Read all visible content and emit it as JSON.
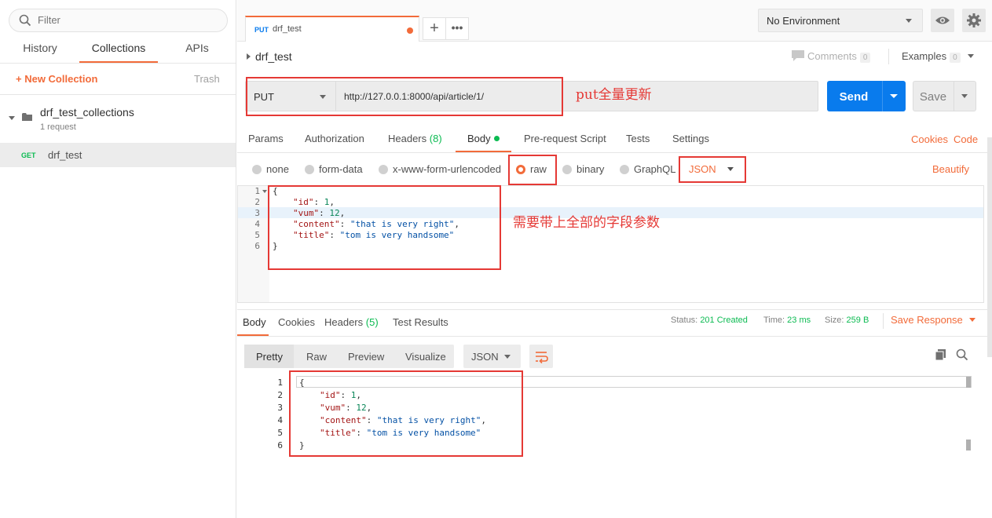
{
  "sidebar": {
    "filter_placeholder": "Filter",
    "tabs": [
      "History",
      "Collections",
      "APIs"
    ],
    "new_collection": "+ New Collection",
    "trash": "Trash",
    "collection": {
      "name": "drf_test_collections",
      "count": "1 request"
    },
    "request": {
      "method": "GET",
      "name": "drf_test"
    }
  },
  "topbar": {
    "tab": {
      "method": "PUT",
      "name": "drf_test"
    },
    "add_tab": "+",
    "more_tabs": "•••",
    "environment": "No Environment",
    "icons": [
      "eye-icon",
      "gear-icon"
    ]
  },
  "request": {
    "title": "drf_test",
    "comments_label": "Comments",
    "comments_count": "0",
    "examples_label": "Examples",
    "examples_count": "0",
    "method": "PUT",
    "url": "http://127.0.0.1:8000/api/article/1/",
    "send_label": "Send",
    "save_label": "Save",
    "tabs": {
      "params": "Params",
      "authorization": "Authorization",
      "headers": "Headers",
      "headers_count": "(8)",
      "body": "Body",
      "prerequest": "Pre-request Script",
      "tests": "Tests",
      "settings": "Settings"
    },
    "cookies_link": "Cookies",
    "code_link": "Code",
    "body_modes": [
      "none",
      "form-data",
      "x-www-form-urlencoded",
      "raw",
      "binary",
      "GraphQL"
    ],
    "selected_mode": "raw",
    "language": "JSON",
    "beautify": "Beautify",
    "line_numbers": [
      "1",
      "2",
      "3",
      "4",
      "5",
      "6"
    ]
  },
  "response": {
    "tabs": {
      "body": "Body",
      "cookies": "Cookies",
      "headers": "Headers",
      "headers_count": "(5)",
      "tests": "Test Results"
    },
    "status_label": "Status:",
    "status_value": "201 Created",
    "time_label": "Time:",
    "time_value": "23 ms",
    "size_label": "Size:",
    "size_value": "259 B",
    "save_response": "Save Response",
    "formats": [
      "Pretty",
      "Raw",
      "Preview",
      "Visualize"
    ],
    "language": "JSON",
    "line_numbers": [
      "1",
      "2",
      "3",
      "4",
      "5",
      "6"
    ]
  },
  "json_body": {
    "open": "{",
    "close": "}",
    "id_key": "\"id\"",
    "id_val": "1",
    "vum_key": "\"vum\"",
    "vum_val": "12",
    "content_key": "\"content\"",
    "content_val": "\"that is very right\"",
    "title_key": "\"title\"",
    "title_val": "\"tom is very handsome\""
  },
  "annotations": {
    "put_note": "put全量更新",
    "body_note": "需要带上全部的字段参数"
  },
  "colors": {
    "accent": "#f26b3a",
    "send_blue": "#097bed",
    "success_green": "#0cbb52",
    "annotation_red": "#e53935"
  }
}
